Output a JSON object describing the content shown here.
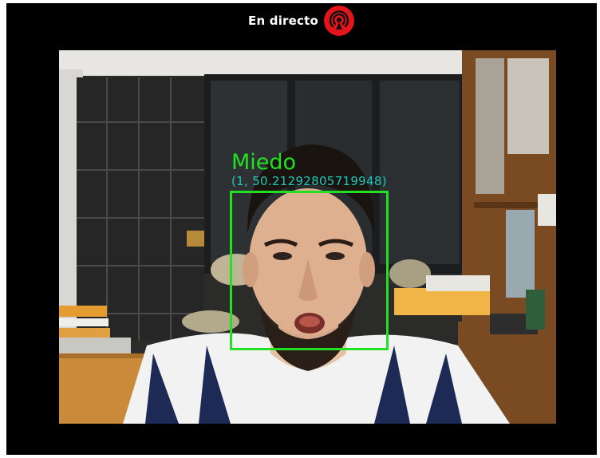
{
  "header": {
    "live_label": "En directo",
    "live_icon": "broadcast-icon",
    "live_icon_color": "#e3141a"
  },
  "detection": {
    "emotion": "Miedo",
    "score_text": "(1, 50.21292805719948)",
    "box_color": "#21e121",
    "score_color": "#21c7b8"
  }
}
